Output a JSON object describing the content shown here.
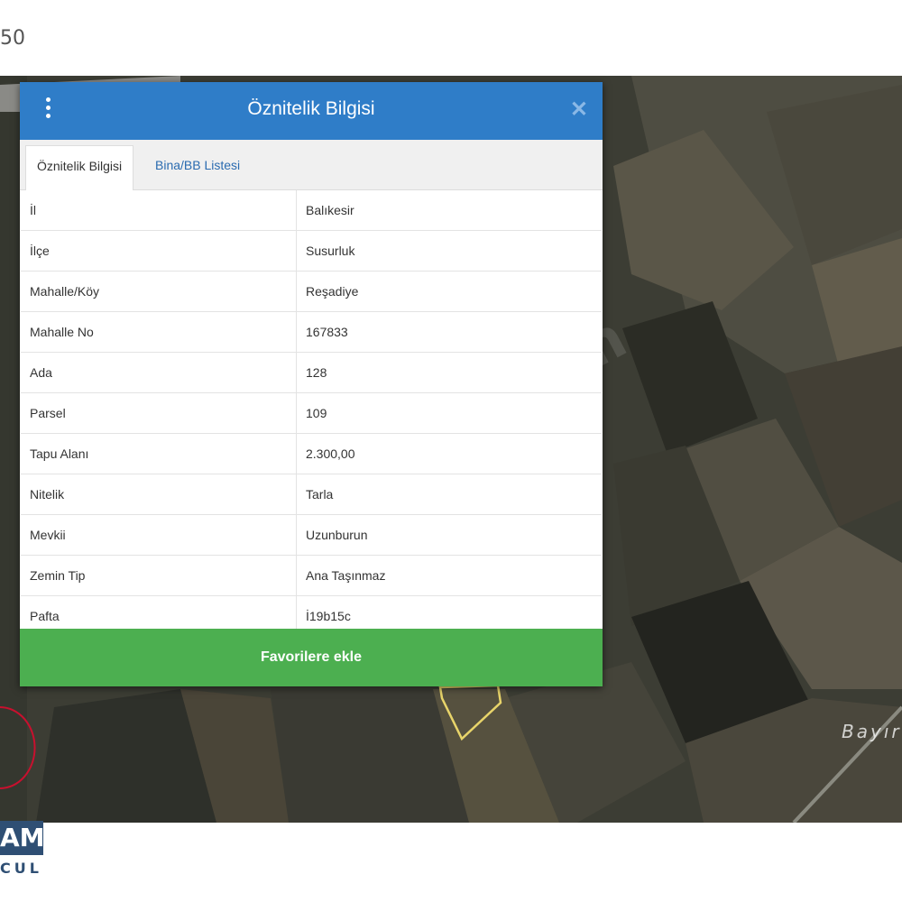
{
  "top_label": "50",
  "map": {
    "watermark": "om",
    "place_label": "Bayır"
  },
  "dialog": {
    "title": "Öznitelik Bilgisi",
    "menu_icon": "kebab-menu-icon",
    "close_icon": "close-icon",
    "tabs": [
      {
        "label": "Öznitelik Bilgisi",
        "active": true
      },
      {
        "label": "Bina/BB Listesi",
        "active": false
      }
    ],
    "rows": [
      {
        "key": "İl",
        "value": "Balıkesir"
      },
      {
        "key": "İlçe",
        "value": "Susurluk"
      },
      {
        "key": "Mahalle/Köy",
        "value": "Reşadiye"
      },
      {
        "key": "Mahalle No",
        "value": "167833"
      },
      {
        "key": "Ada",
        "value": "128"
      },
      {
        "key": "Parsel",
        "value": "109"
      },
      {
        "key": "Tapu Alanı",
        "value": "2.300,00"
      },
      {
        "key": "Nitelik",
        "value": "Tarla"
      },
      {
        "key": "Mevkii",
        "value": "Uzunburun"
      },
      {
        "key": "Zemin Tip",
        "value": "Ana Taşınmaz"
      },
      {
        "key": "Pafta",
        "value": "İ19b15c"
      }
    ],
    "favorite_button": "Favorilere ekle"
  },
  "logo": {
    "text": "AM",
    "subtext": "CUL"
  },
  "colors": {
    "header": "#2f7dc8",
    "favorite_button": "#4caf50",
    "parcel_outline": "#e8d46a",
    "marker": "#c8102e"
  }
}
